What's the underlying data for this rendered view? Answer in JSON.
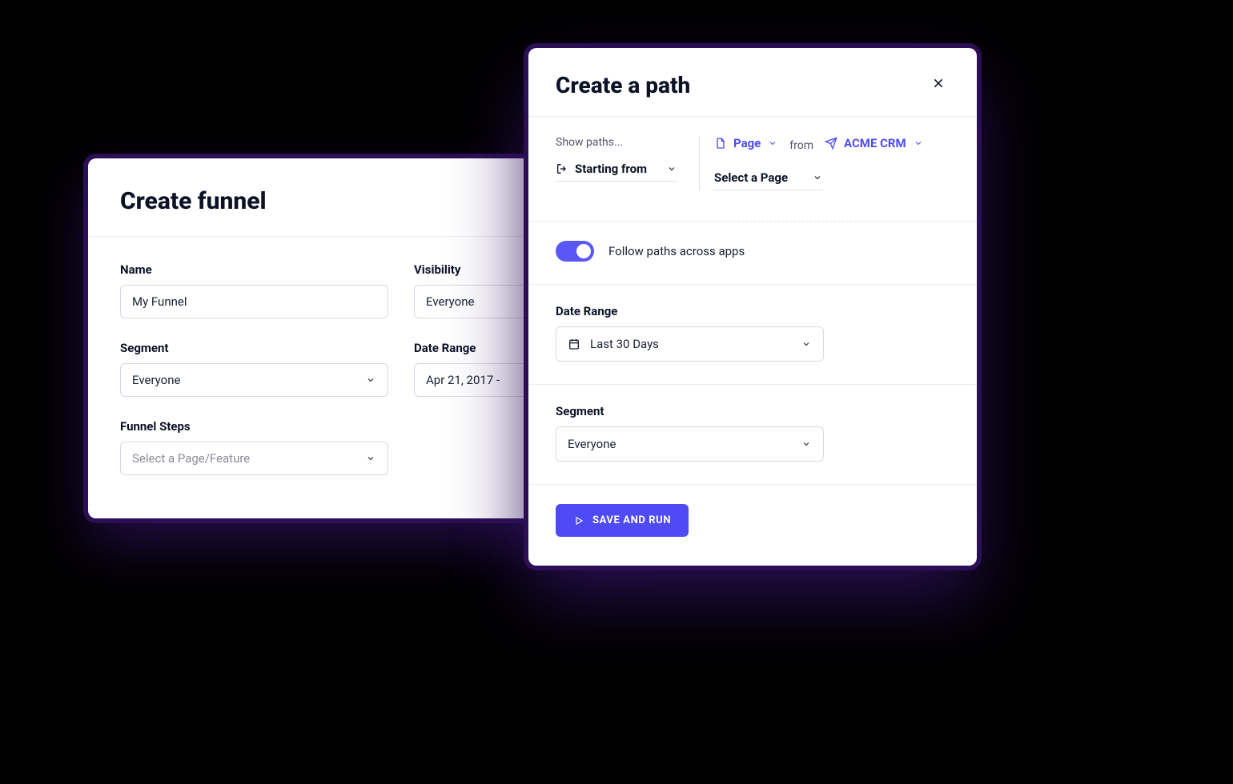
{
  "funnel": {
    "title": "Create funnel",
    "name_label": "Name",
    "name_value": "My Funnel",
    "visibility_label": "Visibility",
    "visibility_value": "Everyone",
    "segment_label": "Segment",
    "segment_value": "Everyone",
    "date_range_label": "Date Range",
    "date_range_value": "Apr 21, 2017 -",
    "steps_label": "Funnel Steps",
    "steps_placeholder": "Select a Page/Feature"
  },
  "path": {
    "title": "Create a path",
    "show_paths_label": "Show paths...",
    "starting_from_label": "Starting from",
    "page_label": "Page",
    "from_label": "from",
    "app_label": "ACME CRM",
    "select_page_label": "Select a Page",
    "toggle_label": "Follow paths across apps",
    "toggle_on": true,
    "date_range_label": "Date Range",
    "date_range_value": "Last 30 Days",
    "segment_label": "Segment",
    "segment_value": "Everyone",
    "save_button": "Save and Run"
  }
}
